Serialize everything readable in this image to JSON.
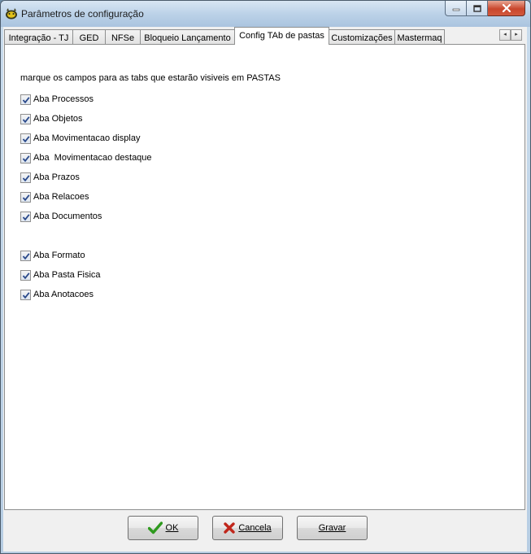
{
  "window": {
    "title": "Parâmetros de configuração",
    "controls": {
      "minimize": "minimize-icon",
      "maximize": "maximize-icon",
      "close": "close-icon"
    }
  },
  "tabs": [
    {
      "label": "Integração - TJ",
      "active": false
    },
    {
      "label": "GED",
      "active": false
    },
    {
      "label": "NFSe",
      "active": false
    },
    {
      "label": "Bloqueio Lançamento",
      "active": false
    },
    {
      "label": "Config TAb de pastas",
      "active": true
    },
    {
      "label": "Customizações",
      "active": false
    },
    {
      "label": "Mastermaq",
      "active": false
    }
  ],
  "tab_scroll": {
    "left": "◂",
    "right": "▸"
  },
  "panel": {
    "caption": "marque os campos para as tabs que estarão visiveis em  PASTAS",
    "checkboxes": [
      {
        "label": "Aba Processos",
        "checked": true
      },
      {
        "label": "Aba Objetos",
        "checked": true
      },
      {
        "label": "Aba Movimentacao display",
        "checked": true
      },
      {
        "label": "Aba  Movimentacao destaque",
        "checked": true
      },
      {
        "label": "Aba Prazos",
        "checked": true
      },
      {
        "label": "Aba Relacoes",
        "checked": true
      },
      {
        "label": "Aba Documentos",
        "checked": true
      },
      {
        "label": "Aba Formato",
        "checked": true
      },
      {
        "label": "Aba Pasta Fisica",
        "checked": true
      },
      {
        "label": "Aba Anotacoes",
        "checked": true
      }
    ]
  },
  "buttons": {
    "ok": "OK",
    "cancel": "Cancela",
    "save": "Gravar"
  },
  "colors": {
    "checkmark": "#2b4a8b",
    "ok_icon": "#2e9a1e",
    "cancel_icon": "#c0261b"
  }
}
